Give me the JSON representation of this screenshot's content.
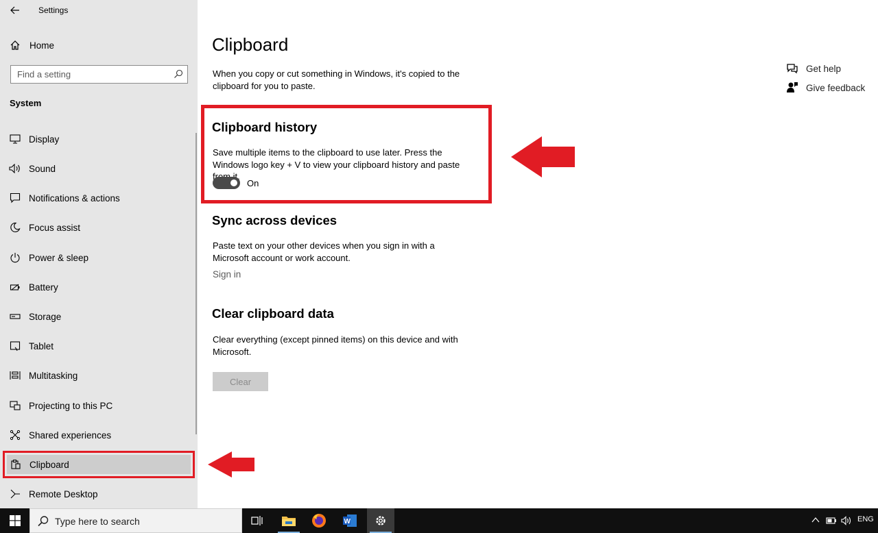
{
  "window": {
    "title": "Settings"
  },
  "sidebar": {
    "home_label": "Home",
    "search_placeholder": "Find a setting",
    "section_title": "System",
    "items": [
      {
        "label": "Display",
        "icon": "monitor-icon"
      },
      {
        "label": "Sound",
        "icon": "speaker-icon"
      },
      {
        "label": "Notifications & actions",
        "icon": "message-icon"
      },
      {
        "label": "Focus assist",
        "icon": "moon-icon"
      },
      {
        "label": "Power & sleep",
        "icon": "power-icon"
      },
      {
        "label": "Battery",
        "icon": "battery-icon"
      },
      {
        "label": "Storage",
        "icon": "storage-icon"
      },
      {
        "label": "Tablet",
        "icon": "tablet-icon"
      },
      {
        "label": "Multitasking",
        "icon": "multitasking-icon"
      },
      {
        "label": "Projecting to this PC",
        "icon": "projector-icon"
      },
      {
        "label": "Shared experiences",
        "icon": "share-icon"
      },
      {
        "label": "Clipboard",
        "icon": "clipboard-icon",
        "selected": true
      },
      {
        "label": "Remote Desktop",
        "icon": "remote-icon"
      }
    ]
  },
  "main": {
    "title": "Clipboard",
    "intro": "When you copy or cut something in Windows, it's copied to the clipboard for you to paste.",
    "history": {
      "heading": "Clipboard history",
      "desc": "Save multiple items to the clipboard to use later. Press the Windows logo key + V to view your clipboard history and paste from it.",
      "toggle_state": "On"
    },
    "sync": {
      "heading": "Sync across devices",
      "desc": "Paste text on your other devices when you sign in with a Microsoft account or work account.",
      "link": "Sign in"
    },
    "clear": {
      "heading": "Clear clipboard data",
      "desc": "Clear everything (except pinned items) on this device and with Microsoft.",
      "button": "Clear"
    },
    "help": {
      "get_help": "Get help",
      "give_feedback": "Give feedback"
    }
  },
  "taskbar": {
    "search_placeholder": "Type here to search",
    "language": "ENG"
  },
  "colors": {
    "highlight_red": "#e11c24",
    "sidebar_bg": "#e6e6e6",
    "taskbar_bg": "#101010"
  }
}
